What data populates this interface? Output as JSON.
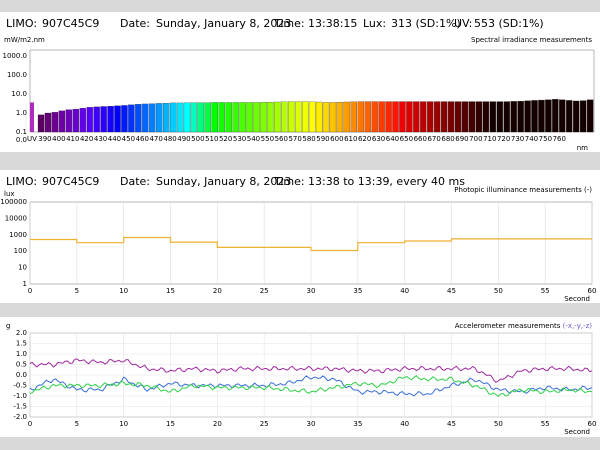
{
  "panel1": {
    "limo_label": "LIMO:",
    "limo_value": "907C45C9",
    "date_label": "Date:",
    "date_value": "Sunday, January 8, 2023",
    "time_label": "Time:",
    "time_value": "13:38:15",
    "lux_label": "Lux:",
    "lux_value": "313 (SD:1%)",
    "uv_label": "UV:",
    "uv_value": "553 (SD:1%)"
  },
  "panel2": {
    "limo_label": "LIMO:",
    "limo_value": "907C45C9",
    "date_label": "Date:",
    "date_value": "Sunday, January 8, 2023",
    "time_label": "Time:",
    "time_value": "13:38 to 13:39, every 40 ms"
  },
  "chart_data": [
    {
      "type": "bar",
      "title": "Spectral irradiance measurements",
      "ylabel": "mW/m2.nm",
      "xlabel": "nm",
      "y_scale": "log",
      "ylim": [
        0.1,
        1000
      ],
      "yticks": [
        "1000.0",
        "100.0",
        "10.0",
        "1.0",
        "0.1",
        "0.0"
      ],
      "xticks": [
        "UV",
        "390",
        "400",
        "410",
        "420",
        "430",
        "440",
        "450",
        "460",
        "470",
        "480",
        "490",
        "500",
        "510",
        "520",
        "530",
        "540",
        "550",
        "560",
        "570",
        "580",
        "590",
        "600",
        "610",
        "620",
        "630",
        "640",
        "650",
        "660",
        "670",
        "680",
        "690",
        "700",
        "710",
        "720",
        "730",
        "740",
        "750",
        "760"
      ],
      "uv_value": 3.6,
      "uv_color": "#b02cc0",
      "wavelengths_start": 385,
      "wavelengths_step": 5,
      "values": [
        0.8,
        1.0,
        1.1,
        1.3,
        1.5,
        1.6,
        1.8,
        2.0,
        2.1,
        2.2,
        2.3,
        2.4,
        2.5,
        2.7,
        2.9,
        3.0,
        3.1,
        3.2,
        3.3,
        3.4,
        3.4,
        3.5,
        3.5,
        3.5,
        3.5,
        3.6,
        3.6,
        3.6,
        3.6,
        3.6,
        3.6,
        3.6,
        3.7,
        3.7,
        3.8,
        3.9,
        4.0,
        4.0,
        4.0,
        3.9,
        3.8,
        3.6,
        3.6,
        3.7,
        3.8,
        3.9,
        4.0,
        4.0,
        4.0,
        4.0,
        4.0,
        4.0,
        4.0,
        4.0,
        4.0,
        4.0,
        4.0,
        4.0,
        4.0,
        4.0,
        4.0,
        4.0,
        4.0,
        4.0,
        4.0,
        4.0,
        4.0,
        4.0,
        4.1,
        4.2,
        4.4,
        4.6,
        4.8,
        5.0,
        5.3,
        5.0,
        4.6,
        4.3,
        4.5,
        5.0
      ]
    },
    {
      "type": "line",
      "title": "Photopic illuminance measurements (-)",
      "ylabel": "lux",
      "xlabel": "Second",
      "y_scale": "log",
      "ylim": [
        1,
        100000
      ],
      "yticks": [
        "100000",
        "10000",
        "1000",
        "100",
        "10",
        "1"
      ],
      "xlim": [
        0,
        60
      ],
      "xticks": [
        "0",
        "5",
        "10",
        "15",
        "20",
        "25",
        "30",
        "35",
        "40",
        "45",
        "50",
        "55",
        "60"
      ],
      "color": "#f0b030",
      "x": [
        0,
        5,
        5,
        10,
        10,
        15,
        15,
        20,
        20,
        30,
        30,
        35,
        35,
        40,
        40,
        45,
        45,
        60
      ],
      "y": [
        520,
        520,
        330,
        330,
        680,
        680,
        360,
        360,
        170,
        170,
        110,
        110,
        330,
        330,
        420,
        420,
        560,
        560
      ]
    },
    {
      "type": "line",
      "title": "Accelerometer measurements",
      "legend": "(-x,-y,-z)",
      "ylabel": "g",
      "xlabel": "Second",
      "ylim": [
        -2.0,
        2.0
      ],
      "yticks": [
        "2.0",
        "1.5",
        "1.0",
        "0.5",
        "0.0",
        "-0.5",
        "-1.0",
        "-1.5",
        "-2.0"
      ],
      "xlim": [
        0,
        60
      ],
      "xticks": [
        "0",
        "5",
        "10",
        "15",
        "20",
        "25",
        "30",
        "35",
        "40",
        "45",
        "50",
        "55",
        "60"
      ],
      "x": [
        0,
        2.5,
        5,
        7.5,
        10,
        12.5,
        15,
        17.5,
        20,
        22.5,
        25,
        27.5,
        30,
        32.5,
        35,
        37.5,
        40,
        42.5,
        45,
        47.5,
        50,
        52.5,
        55,
        57.5,
        60
      ],
      "series": [
        {
          "color": "#a02aa0",
          "values": [
            0.5,
            0.5,
            0.7,
            0.6,
            0.7,
            0.3,
            0.2,
            0.3,
            0.2,
            0.3,
            0.3,
            0.3,
            0.3,
            0.3,
            0.2,
            0.2,
            0.3,
            0.3,
            0.3,
            0.3,
            -0.3,
            0.2,
            0.3,
            0.3,
            0.2
          ]
        },
        {
          "color": "#3a6fd8",
          "values": [
            -0.7,
            -0.2,
            -0.7,
            -0.7,
            -0.2,
            -0.7,
            -0.4,
            -0.5,
            -0.5,
            -0.5,
            -0.5,
            -0.4,
            -0.1,
            -0.2,
            -0.8,
            -0.8,
            -0.9,
            -0.9,
            -0.5,
            -0.2,
            -0.7,
            -0.8,
            -0.6,
            -0.7,
            -0.6
          ]
        },
        {
          "color": "#30d048",
          "values": [
            -0.8,
            -0.5,
            -0.5,
            -0.5,
            -0.4,
            -0.5,
            -0.8,
            -0.5,
            -0.6,
            -0.6,
            -0.6,
            -0.7,
            -0.8,
            -0.6,
            -0.4,
            -0.5,
            -0.1,
            -0.2,
            -0.2,
            -0.5,
            -1.0,
            -0.7,
            -0.8,
            -0.7,
            -0.8
          ]
        }
      ]
    }
  ]
}
